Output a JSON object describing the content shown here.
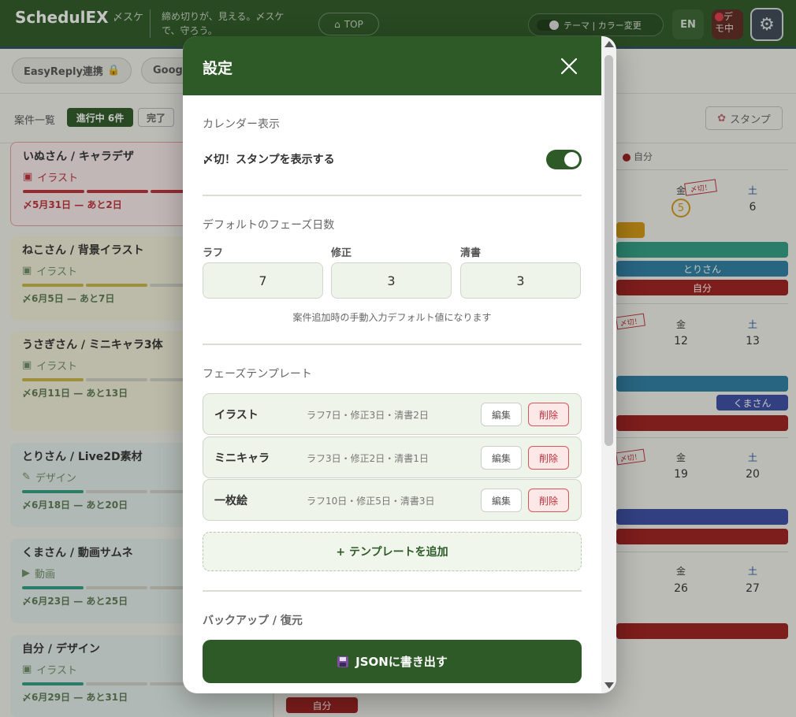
{
  "header": {
    "logo": "SchedulEX",
    "tag": "〆スケ",
    "tagline": "締め切りが、見える。〆スケで、守ろう。",
    "top_label": "TOP",
    "theme_label": "テーマ | カラー変更",
    "lang_label": "EN",
    "demo_label": "デモ中"
  },
  "integrations": [
    "EasyReply連携",
    "Goog"
  ],
  "list": {
    "label": "案件一覧",
    "active_chip": "進行中 6件",
    "done_chip": "完了",
    "stamp_label": "スタンプ"
  },
  "cards": [
    {
      "title": "いぬさん / キャラデザ",
      "kind": "イラスト",
      "date": "〆5月31日 — あと2日"
    },
    {
      "title": "ねこさん / 背景イラスト",
      "kind": "イラスト",
      "date": "〆6月5日 — あと7日"
    },
    {
      "title": "うさぎさん / ミニキャラ3体",
      "kind": "イラスト",
      "date": "〆6月11日 — あと13日"
    },
    {
      "title": "とりさん / Live2D素材",
      "kind": "デザイン",
      "date": "〆6月18日 — あと20日"
    },
    {
      "title": "くまさん / 動画サムネ",
      "kind": "動画",
      "date": "〆6月23日 — あと25日"
    },
    {
      "title": "自分 / デザイン",
      "kind": "イラスト",
      "date": "〆6月29日 — あと31日"
    }
  ],
  "calendar": {
    "legend": "自分",
    "weekday_fri": "金",
    "weekday_sat": "土",
    "stamp": "〆切！",
    "dates": {
      "w1_fri": "5",
      "w1_sat": "6",
      "w2_fri": "12",
      "w2_sat": "13",
      "w3_fri": "19",
      "w3_sat": "20",
      "w4_fri": "26",
      "w4_sat": "27"
    },
    "events": {
      "tori": "とりさん",
      "self": "自分",
      "kuma": "くまさん",
      "self_bottom": "自分"
    }
  },
  "modal": {
    "title": "設定",
    "calendar_section": "カレンダー表示",
    "stamp_toggle_label": "〆切！スタンプを表示する",
    "stamp_toggle_on": true,
    "phase_days_section": "デフォルトのフェーズ日数",
    "fields": [
      {
        "label": "ラフ",
        "value": "7"
      },
      {
        "label": "修正",
        "value": "3"
      },
      {
        "label": "清書",
        "value": "3"
      }
    ],
    "hint": "案件追加時の手動入力デフォルト値になります",
    "template_section": "フェーズテンプレート",
    "templates": [
      {
        "name": "イラスト",
        "summary": "ラフ7日・修正3日・清書2日"
      },
      {
        "name": "ミニキャラ",
        "summary": "ラフ3日・修正2日・清書1日"
      },
      {
        "name": "一枚絵",
        "summary": "ラフ10日・修正5日・清書3日"
      }
    ],
    "edit_label": "編集",
    "delete_label": "削除",
    "add_template_label": "+ テンプレートを追加",
    "backup_section": "バックアップ / 復元",
    "export_label": "JSONに書き出す"
  },
  "colors": {
    "primary": "#2d5a27",
    "danger": "#c0303a",
    "event_red": "#a01e1e",
    "event_blue": "#2d7fa6",
    "event_teal": "#2f9f86",
    "event_orange": "#d69a13",
    "event_indigo": "#3b4ea8"
  }
}
